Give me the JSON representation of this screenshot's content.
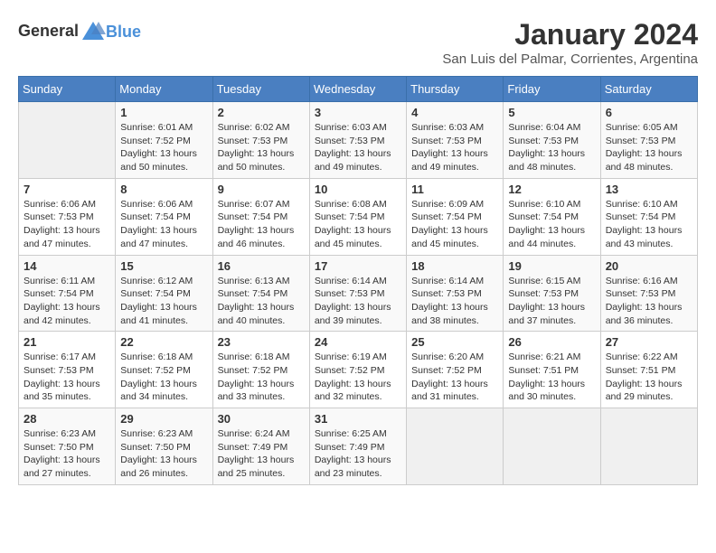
{
  "header": {
    "logo_general": "General",
    "logo_blue": "Blue",
    "title": "January 2024",
    "subtitle": "San Luis del Palmar, Corrientes, Argentina"
  },
  "days_of_week": [
    "Sunday",
    "Monday",
    "Tuesday",
    "Wednesday",
    "Thursday",
    "Friday",
    "Saturday"
  ],
  "weeks": [
    [
      {
        "day": "",
        "info": ""
      },
      {
        "day": "1",
        "info": "Sunrise: 6:01 AM\nSunset: 7:52 PM\nDaylight: 13 hours\nand 50 minutes."
      },
      {
        "day": "2",
        "info": "Sunrise: 6:02 AM\nSunset: 7:53 PM\nDaylight: 13 hours\nand 50 minutes."
      },
      {
        "day": "3",
        "info": "Sunrise: 6:03 AM\nSunset: 7:53 PM\nDaylight: 13 hours\nand 49 minutes."
      },
      {
        "day": "4",
        "info": "Sunrise: 6:03 AM\nSunset: 7:53 PM\nDaylight: 13 hours\nand 49 minutes."
      },
      {
        "day": "5",
        "info": "Sunrise: 6:04 AM\nSunset: 7:53 PM\nDaylight: 13 hours\nand 48 minutes."
      },
      {
        "day": "6",
        "info": "Sunrise: 6:05 AM\nSunset: 7:53 PM\nDaylight: 13 hours\nand 48 minutes."
      }
    ],
    [
      {
        "day": "7",
        "info": "Sunrise: 6:06 AM\nSunset: 7:53 PM\nDaylight: 13 hours\nand 47 minutes."
      },
      {
        "day": "8",
        "info": "Sunrise: 6:06 AM\nSunset: 7:54 PM\nDaylight: 13 hours\nand 47 minutes."
      },
      {
        "day": "9",
        "info": "Sunrise: 6:07 AM\nSunset: 7:54 PM\nDaylight: 13 hours\nand 46 minutes."
      },
      {
        "day": "10",
        "info": "Sunrise: 6:08 AM\nSunset: 7:54 PM\nDaylight: 13 hours\nand 45 minutes."
      },
      {
        "day": "11",
        "info": "Sunrise: 6:09 AM\nSunset: 7:54 PM\nDaylight: 13 hours\nand 45 minutes."
      },
      {
        "day": "12",
        "info": "Sunrise: 6:10 AM\nSunset: 7:54 PM\nDaylight: 13 hours\nand 44 minutes."
      },
      {
        "day": "13",
        "info": "Sunrise: 6:10 AM\nSunset: 7:54 PM\nDaylight: 13 hours\nand 43 minutes."
      }
    ],
    [
      {
        "day": "14",
        "info": "Sunrise: 6:11 AM\nSunset: 7:54 PM\nDaylight: 13 hours\nand 42 minutes."
      },
      {
        "day": "15",
        "info": "Sunrise: 6:12 AM\nSunset: 7:54 PM\nDaylight: 13 hours\nand 41 minutes."
      },
      {
        "day": "16",
        "info": "Sunrise: 6:13 AM\nSunset: 7:54 PM\nDaylight: 13 hours\nand 40 minutes."
      },
      {
        "day": "17",
        "info": "Sunrise: 6:14 AM\nSunset: 7:53 PM\nDaylight: 13 hours\nand 39 minutes."
      },
      {
        "day": "18",
        "info": "Sunrise: 6:14 AM\nSunset: 7:53 PM\nDaylight: 13 hours\nand 38 minutes."
      },
      {
        "day": "19",
        "info": "Sunrise: 6:15 AM\nSunset: 7:53 PM\nDaylight: 13 hours\nand 37 minutes."
      },
      {
        "day": "20",
        "info": "Sunrise: 6:16 AM\nSunset: 7:53 PM\nDaylight: 13 hours\nand 36 minutes."
      }
    ],
    [
      {
        "day": "21",
        "info": "Sunrise: 6:17 AM\nSunset: 7:53 PM\nDaylight: 13 hours\nand 35 minutes."
      },
      {
        "day": "22",
        "info": "Sunrise: 6:18 AM\nSunset: 7:52 PM\nDaylight: 13 hours\nand 34 minutes."
      },
      {
        "day": "23",
        "info": "Sunrise: 6:18 AM\nSunset: 7:52 PM\nDaylight: 13 hours\nand 33 minutes."
      },
      {
        "day": "24",
        "info": "Sunrise: 6:19 AM\nSunset: 7:52 PM\nDaylight: 13 hours\nand 32 minutes."
      },
      {
        "day": "25",
        "info": "Sunrise: 6:20 AM\nSunset: 7:52 PM\nDaylight: 13 hours\nand 31 minutes."
      },
      {
        "day": "26",
        "info": "Sunrise: 6:21 AM\nSunset: 7:51 PM\nDaylight: 13 hours\nand 30 minutes."
      },
      {
        "day": "27",
        "info": "Sunrise: 6:22 AM\nSunset: 7:51 PM\nDaylight: 13 hours\nand 29 minutes."
      }
    ],
    [
      {
        "day": "28",
        "info": "Sunrise: 6:23 AM\nSunset: 7:50 PM\nDaylight: 13 hours\nand 27 minutes."
      },
      {
        "day": "29",
        "info": "Sunrise: 6:23 AM\nSunset: 7:50 PM\nDaylight: 13 hours\nand 26 minutes."
      },
      {
        "day": "30",
        "info": "Sunrise: 6:24 AM\nSunset: 7:49 PM\nDaylight: 13 hours\nand 25 minutes."
      },
      {
        "day": "31",
        "info": "Sunrise: 6:25 AM\nSunset: 7:49 PM\nDaylight: 13 hours\nand 23 minutes."
      },
      {
        "day": "",
        "info": ""
      },
      {
        "day": "",
        "info": ""
      },
      {
        "day": "",
        "info": ""
      }
    ]
  ]
}
